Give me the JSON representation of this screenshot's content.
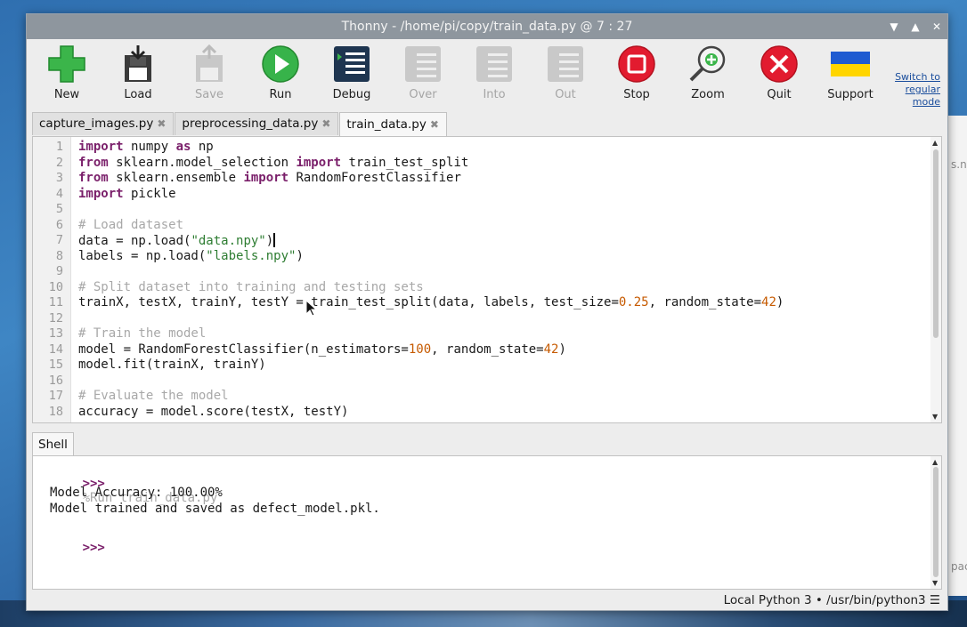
{
  "window": {
    "title": "Thonny  -  /home/pi/copy/train_data.py  @  7 : 27"
  },
  "toolbar": {
    "buttons": [
      {
        "label": "New",
        "enabled": true,
        "icon": "new-file-icon"
      },
      {
        "label": "Load",
        "enabled": true,
        "icon": "load-icon"
      },
      {
        "label": "Save",
        "enabled": false,
        "icon": "save-icon"
      },
      {
        "label": "Run",
        "enabled": true,
        "icon": "run-icon"
      },
      {
        "label": "Debug",
        "enabled": true,
        "icon": "debug-icon"
      },
      {
        "label": "Over",
        "enabled": false,
        "icon": "step-over-icon"
      },
      {
        "label": "Into",
        "enabled": false,
        "icon": "step-into-icon"
      },
      {
        "label": "Out",
        "enabled": false,
        "icon": "step-out-icon"
      },
      {
        "label": "Stop",
        "enabled": true,
        "icon": "stop-icon"
      },
      {
        "label": "Zoom",
        "enabled": true,
        "icon": "zoom-icon"
      },
      {
        "label": "Quit",
        "enabled": true,
        "icon": "quit-icon"
      },
      {
        "label": "Support",
        "enabled": true,
        "icon": "ukraine-flag-icon"
      }
    ],
    "mode_link": "Switch to regular mode"
  },
  "tabs": [
    {
      "label": "capture_images.py",
      "active": false
    },
    {
      "label": "preprocessing_data.py",
      "active": false
    },
    {
      "label": "train_data.py",
      "active": true
    }
  ],
  "editor": {
    "line_numbers": [
      "1",
      "2",
      "3",
      "4",
      "5",
      "6",
      "7",
      "8",
      "9",
      "10",
      "11",
      "12",
      "13",
      "14",
      "15",
      "16",
      "17",
      "18"
    ],
    "lines": [
      "import numpy as np",
      "from sklearn.model_selection import train_test_split",
      "from sklearn.ensemble import RandomForestClassifier",
      "import pickle",
      "",
      "# Load dataset",
      "data = np.load(\"data.npy\")",
      "labels = np.load(\"labels.npy\")",
      "",
      "# Split dataset into training and testing sets",
      "trainX, testX, trainY, testY = train_test_split(data, labels, test_size=0.25, random_state=42)",
      "",
      "# Train the model",
      "model = RandomForestClassifier(n_estimators=100, random_state=42)",
      "model.fit(trainX, trainY)",
      "",
      "# Evaluate the model",
      "accuracy = model.score(testX, testY)"
    ]
  },
  "shell": {
    "tab_label": "Shell",
    "prompt": ">>>",
    "command": "%Run train_data.py",
    "output": [
      "Model Accuracy: 100.00%",
      "Model trained and saved as defect_model.pkl."
    ]
  },
  "statusbar": {
    "text": "Local Python 3  •  /usr/bin/python3  ☰"
  },
  "desktop_peek": [
    "s.np",
    "pac"
  ]
}
